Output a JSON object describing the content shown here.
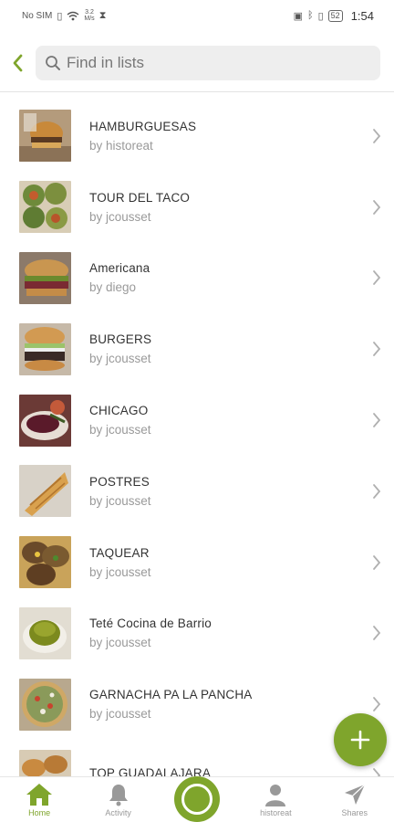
{
  "status_bar": {
    "carrier": "No SIM",
    "speed_value": "3.2",
    "speed_unit": "M/s",
    "battery": "52",
    "time": "1:54"
  },
  "search": {
    "placeholder": "Find in lists",
    "value": ""
  },
  "lists": [
    {
      "title": "HAMBURGUESAS",
      "subtitle": "by historeat",
      "thumb": "burger-photo"
    },
    {
      "title": "TOUR DEL TACO",
      "subtitle": "by jcousset",
      "thumb": "tacos-photo"
    },
    {
      "title": "Americana",
      "subtitle": "by diego",
      "thumb": "burger-photo"
    },
    {
      "title": "BURGERS",
      "subtitle": "by jcousset",
      "thumb": "burger-photo"
    },
    {
      "title": "CHICAGO",
      "subtitle": "by jcousset",
      "thumb": "beets-photo"
    },
    {
      "title": "POSTRES",
      "subtitle": "by jcousset",
      "thumb": "crepe-photo"
    },
    {
      "title": "TAQUEAR",
      "subtitle": "by jcousset",
      "thumb": "tacos-photo"
    },
    {
      "title": "Teté Cocina de Barrio",
      "subtitle": "by jcousset",
      "thumb": "mole-photo"
    },
    {
      "title": "GARNACHA PA LA PANCHA",
      "subtitle": "by jcousset",
      "thumb": "tostada-photo"
    },
    {
      "title": "TOP GUADALAJARA",
      "subtitle": "",
      "thumb": "bread-photo"
    }
  ],
  "bottom_nav": {
    "home": "Home",
    "activity": "Activity",
    "profile": "historeat",
    "shares": "Shares"
  },
  "colors": {
    "accent": "#7fa52c",
    "text": "#333333",
    "subtext": "#9a9a9a"
  }
}
